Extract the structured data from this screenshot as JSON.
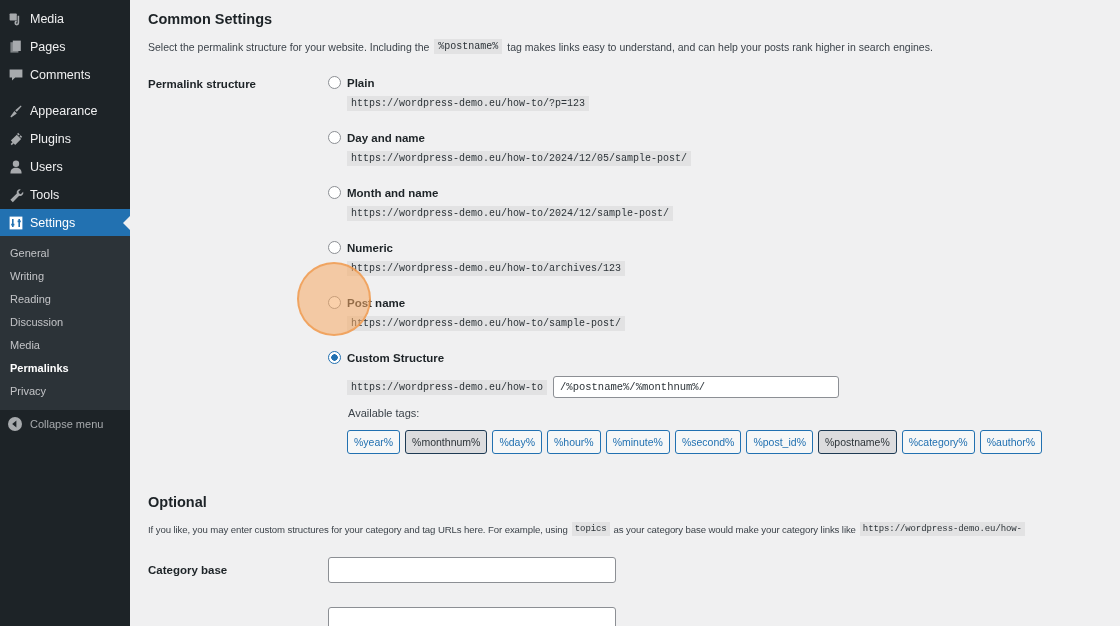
{
  "sidebar": {
    "items": [
      {
        "label": "Media",
        "selected": false
      },
      {
        "label": "Pages",
        "selected": false
      },
      {
        "label": "Comments",
        "selected": false
      },
      {
        "label": "Appearance",
        "selected": false
      },
      {
        "label": "Plugins",
        "selected": false
      },
      {
        "label": "Users",
        "selected": false
      },
      {
        "label": "Tools",
        "selected": false
      },
      {
        "label": "Settings",
        "selected": true
      }
    ],
    "submenu": [
      {
        "label": "General",
        "selected": false
      },
      {
        "label": "Writing",
        "selected": false
      },
      {
        "label": "Reading",
        "selected": false
      },
      {
        "label": "Discussion",
        "selected": false
      },
      {
        "label": "Media",
        "selected": false
      },
      {
        "label": "Permalinks",
        "selected": true
      },
      {
        "label": "Privacy",
        "selected": false
      }
    ],
    "collapse": "Collapse menu"
  },
  "common": {
    "title": "Common Settings",
    "description": [
      {
        "kind": "text",
        "text": "Select the permalink structure for your website. Including the"
      },
      {
        "kind": "code",
        "text": "%postname%"
      },
      {
        "kind": "text",
        "text": "tag makes links easy to understand, and can help your posts rank higher in search engines."
      }
    ],
    "label": "Permalink structure",
    "options": [
      {
        "label": "Plain",
        "example": "https://wordpress-demo.eu/how-to/?p=123",
        "selected": false
      },
      {
        "label": "Day and name",
        "example": "https://wordpress-demo.eu/how-to/2024/12/05/sample-post/",
        "selected": false
      },
      {
        "label": "Month and name",
        "example": "https://wordpress-demo.eu/how-to/2024/12/sample-post/",
        "selected": false
      },
      {
        "label": "Numeric",
        "example": "https://wordpress-demo.eu/how-to/archives/123",
        "selected": false
      },
      {
        "label": "Post name",
        "example": "https://wordpress-demo.eu/how-to/sample-post/",
        "selected": false
      },
      {
        "label": "Custom Structure",
        "selected": true
      }
    ],
    "custom": {
      "prefix": "https://wordpress-demo.eu/how-to",
      "value": "/%postname%/%monthnum%/"
    },
    "tags_label": "Available tags:",
    "tags": [
      {
        "label": "%year%",
        "selected": false
      },
      {
        "label": "%monthnum%",
        "selected": true
      },
      {
        "label": "%day%",
        "selected": false
      },
      {
        "label": "%hour%",
        "selected": false
      },
      {
        "label": "%minute%",
        "selected": false
      },
      {
        "label": "%second%",
        "selected": false
      },
      {
        "label": "%post_id%",
        "selected": false
      },
      {
        "label": "%postname%",
        "selected": true
      },
      {
        "label": "%category%",
        "selected": false
      },
      {
        "label": "%author%",
        "selected": false
      }
    ]
  },
  "optional": {
    "title": "Optional",
    "description": [
      {
        "kind": "text",
        "text": "If you like, you may enter custom structures for your category and tag URLs here. For example, using"
      },
      {
        "kind": "code",
        "text": "topics"
      },
      {
        "kind": "text",
        "text": "as your category base would make your category links like"
      },
      {
        "kind": "code",
        "text": "https://wordpress-demo.eu/how-"
      }
    ],
    "fields": [
      {
        "kind": "text",
        "label": "Category base"
      },
      {
        "kind": "text"
      }
    ]
  },
  "click_highlight": {
    "on": true
  }
}
